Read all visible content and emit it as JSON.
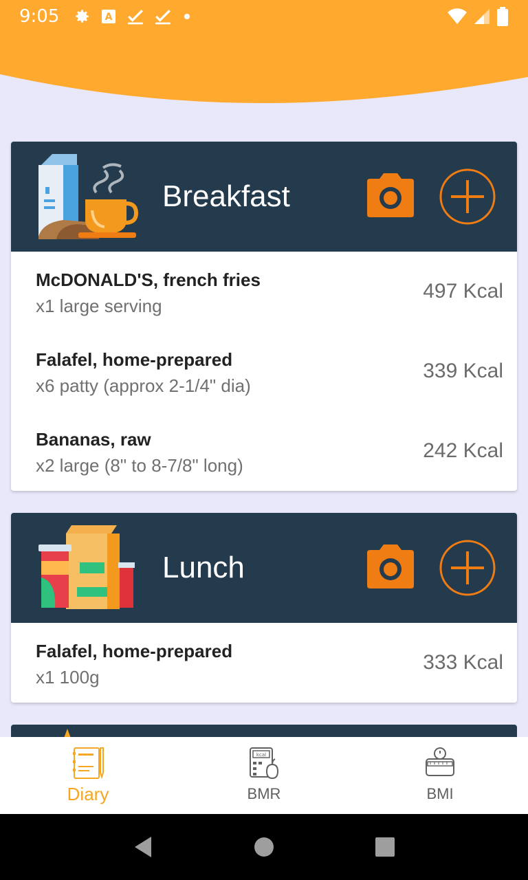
{
  "status_bar": {
    "time": "9:05",
    "icons_left": [
      "gear-icon",
      "font-a-icon",
      "check-icon",
      "check-icon",
      "dot-icon"
    ],
    "icons_right": [
      "wifi-icon",
      "cell-signal-icon",
      "battery-icon"
    ]
  },
  "colors": {
    "header_orange": "#ffa92f",
    "background": "#e9e8fb",
    "card_header": "#243a4d",
    "accent_orange": "#f07d14",
    "nav_active": "#f5a623"
  },
  "meals": [
    {
      "title": "Breakfast",
      "icon": "breakfast-illustration",
      "items": [
        {
          "name": "McDONALD'S, french fries",
          "portion": "x1 large serving",
          "kcal": "497 Kcal"
        },
        {
          "name": "Falafel, home-prepared",
          "portion": "x6 patty (approx 2-1/4\" dia)",
          "kcal": "339 Kcal"
        },
        {
          "name": "Bananas, raw",
          "portion": "x2 large (8\" to 8-7/8\" long)",
          "kcal": "242 Kcal"
        }
      ]
    },
    {
      "title": "Lunch",
      "icon": "lunch-illustration",
      "items": [
        {
          "name": "Falafel, home-prepared",
          "portion": "x1 100g",
          "kcal": "333 Kcal"
        }
      ]
    }
  ],
  "bottom_nav": [
    {
      "label": "Diary",
      "icon": "diary-icon",
      "active": true
    },
    {
      "label": "BMR",
      "icon": "bmr-calculator-icon",
      "active": false
    },
    {
      "label": "BMI",
      "icon": "bmi-scale-icon",
      "active": false
    }
  ],
  "system_nav": [
    "back-icon",
    "home-icon",
    "recents-icon"
  ]
}
